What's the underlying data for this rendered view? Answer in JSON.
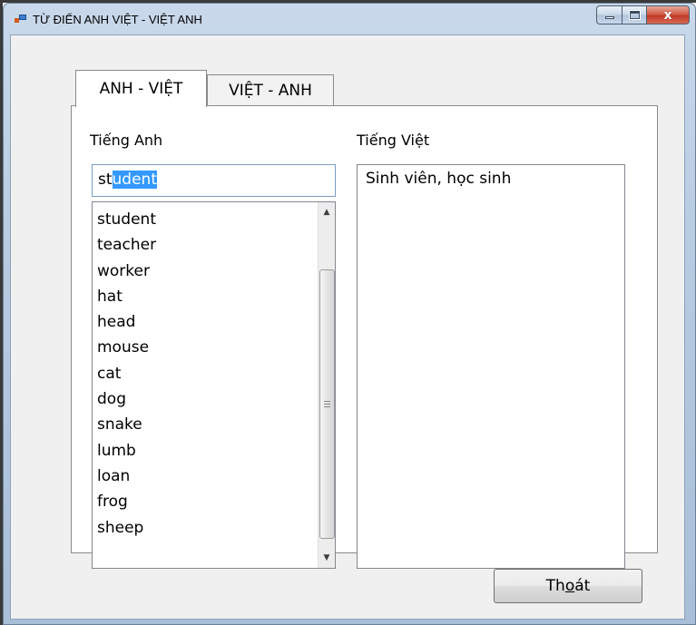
{
  "window": {
    "title": "TỪ ĐIỂN ANH VIỆT - VIỆT ANH",
    "close_glyph": "x"
  },
  "tabs": [
    {
      "label": "ANH - VIỆT",
      "active": true
    },
    {
      "label": "VIỆT - ANH",
      "active": false
    }
  ],
  "english": {
    "label": "Tiếng Anh",
    "input_value": "student",
    "input_value_unselected": "st",
    "input_value_selected": "udent",
    "list_items": [
      "student",
      "teacher",
      "worker",
      "hat",
      "head",
      "mouse",
      "cat",
      "dog",
      "snake",
      "lumb",
      "loan",
      "frog",
      "sheep"
    ]
  },
  "vietnamese": {
    "label": "Tiếng Việt",
    "meaning": "Sinh viên, học sinh"
  },
  "exit_button": {
    "label": "Thoát",
    "label_before_mnemonic": "Th",
    "mnemonic": "o",
    "label_after_mnemonic": "át"
  },
  "icons": [
    "app-icon",
    "minimize-icon",
    "maximize-icon",
    "close-icon",
    "scroll-up-arrow-icon",
    "scroll-down-arrow-icon",
    "scroll-grip-icon"
  ],
  "colors": {
    "selection": "#3399ff",
    "title_bar": "#b7cbe1",
    "close_button": "#c0392b"
  }
}
